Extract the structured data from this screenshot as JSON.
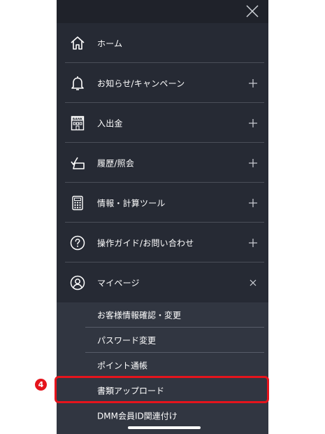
{
  "menu": {
    "items": [
      {
        "label": "ホーム",
        "icon": "home-icon",
        "expand": "none"
      },
      {
        "label": "お知らせ/キャンペーン",
        "icon": "bell-icon",
        "expand": "plus"
      },
      {
        "label": "入出金",
        "icon": "bank-icon",
        "expand": "plus"
      },
      {
        "label": "履歴/照会",
        "icon": "history-icon",
        "expand": "plus"
      },
      {
        "label": "情報・計算ツール",
        "icon": "calculator-icon",
        "expand": "plus"
      },
      {
        "label": "操作ガイド/お問い合わせ",
        "icon": "help-icon",
        "expand": "plus"
      },
      {
        "label": "マイページ",
        "icon": "user-icon",
        "expand": "close"
      }
    ],
    "bank_icon_text": "BANK"
  },
  "mypage_submenu": [
    {
      "label": "お客様情報確認・変更"
    },
    {
      "label": "パスワード変更"
    },
    {
      "label": "ポイント通帳"
    },
    {
      "label": "書類アップロード"
    },
    {
      "label": "DMM会員ID関連付け"
    }
  ],
  "annotation": {
    "step_badge": "4",
    "highlighted_item": "書類アップロード",
    "highlight_color": "#e5141c"
  },
  "colors": {
    "menu_bg": "#262a34",
    "submenu_bg": "#313641",
    "topbar_bg": "#1f222a",
    "text": "#ffffff"
  }
}
